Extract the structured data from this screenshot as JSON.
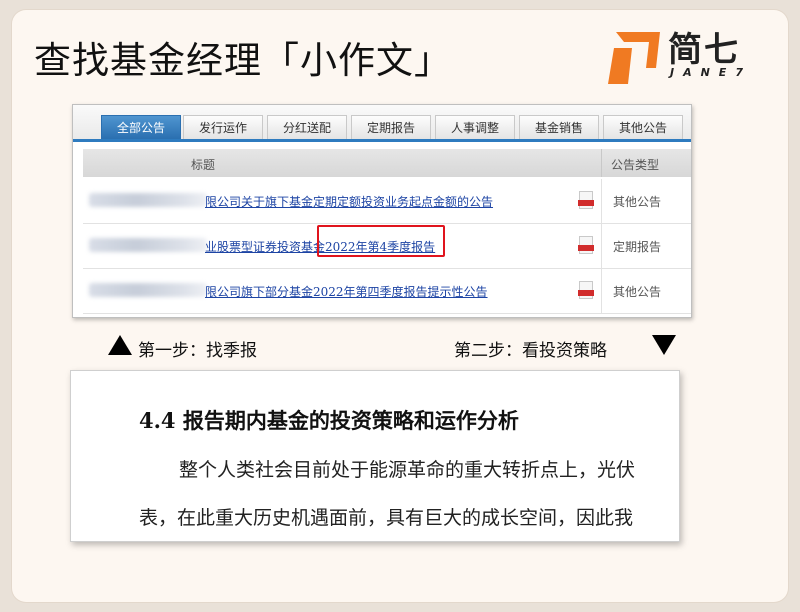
{
  "title": "查找基金经理「小作文」",
  "logo": {
    "cn": "简七",
    "en": "JANE7",
    "color": "#f07a22"
  },
  "tabs": [
    {
      "label": "全部公告",
      "active": true
    },
    {
      "label": "发行运作",
      "active": false
    },
    {
      "label": "分红送配",
      "active": false
    },
    {
      "label": "定期报告",
      "active": false
    },
    {
      "label": "人事调整",
      "active": false
    },
    {
      "label": "基金销售",
      "active": false
    },
    {
      "label": "其他公告",
      "active": false
    }
  ],
  "table": {
    "headers": [
      "标题",
      "公告类型"
    ],
    "rows": [
      {
        "title": "限公司关于旗下基金定期定额投资业务起点金额的公告",
        "type": "其他公告",
        "icon": "pdf-icon"
      },
      {
        "title": "业股票型证券投资基金2022年第4季度报告",
        "type": "定期报告",
        "icon": "pdf-icon"
      },
      {
        "title": "限公司旗下部分基金2022年第四季度报告提示性公告",
        "type": "其他公告",
        "icon": "pdf-icon"
      }
    ]
  },
  "steps": {
    "step1": "第一步：找季报",
    "step2": "第二步：看投资策略"
  },
  "report": {
    "heading": "4.4 报告期内基金的投资策略和运作分析",
    "line1": "整个人类社会目前处于能源革命的重大转折点上，光伏",
    "line2": "表，在此重大历史机遇面前，具有巨大的成长空间，因此我"
  },
  "colors": {
    "accent_red": "#e0141d",
    "tab_blue": "#2e7bbf",
    "link_blue": "#1d44a4"
  }
}
